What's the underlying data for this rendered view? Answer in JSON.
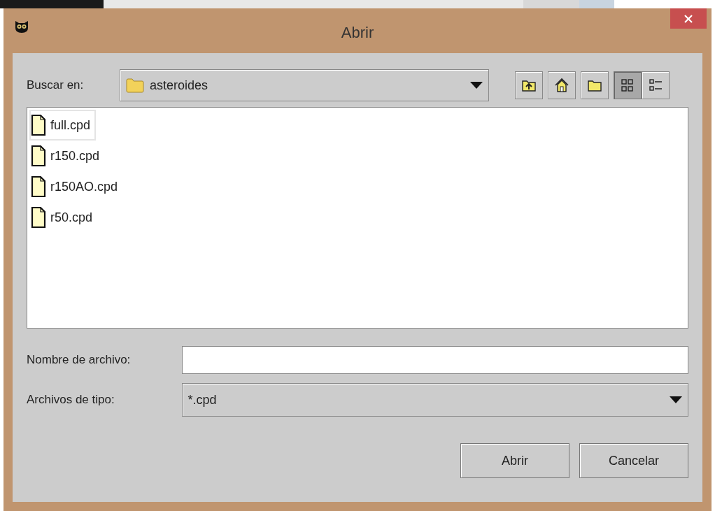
{
  "window": {
    "title": "Abrir"
  },
  "look_in": {
    "label": "Buscar en:",
    "value": "asteroides"
  },
  "toolbar": [
    {
      "kind": "up",
      "pressed": false
    },
    {
      "kind": "home",
      "pressed": false
    },
    {
      "kind": "new-folder",
      "pressed": false
    },
    {
      "kind": "list",
      "pressed": true
    },
    {
      "kind": "details",
      "pressed": false
    }
  ],
  "files": [
    {
      "name": "full.cpd",
      "focused": true
    },
    {
      "name": "r150.cpd",
      "focused": false
    },
    {
      "name": "r150AO.cpd",
      "focused": false
    },
    {
      "name": "r50.cpd",
      "focused": false
    }
  ],
  "file_name": {
    "label": "Nombre de archivo:"
  },
  "file_type": {
    "label": "Archivos de tipo:",
    "value": "*.cpd"
  },
  "buttons": [
    "Abrir",
    "Cancelar"
  ]
}
